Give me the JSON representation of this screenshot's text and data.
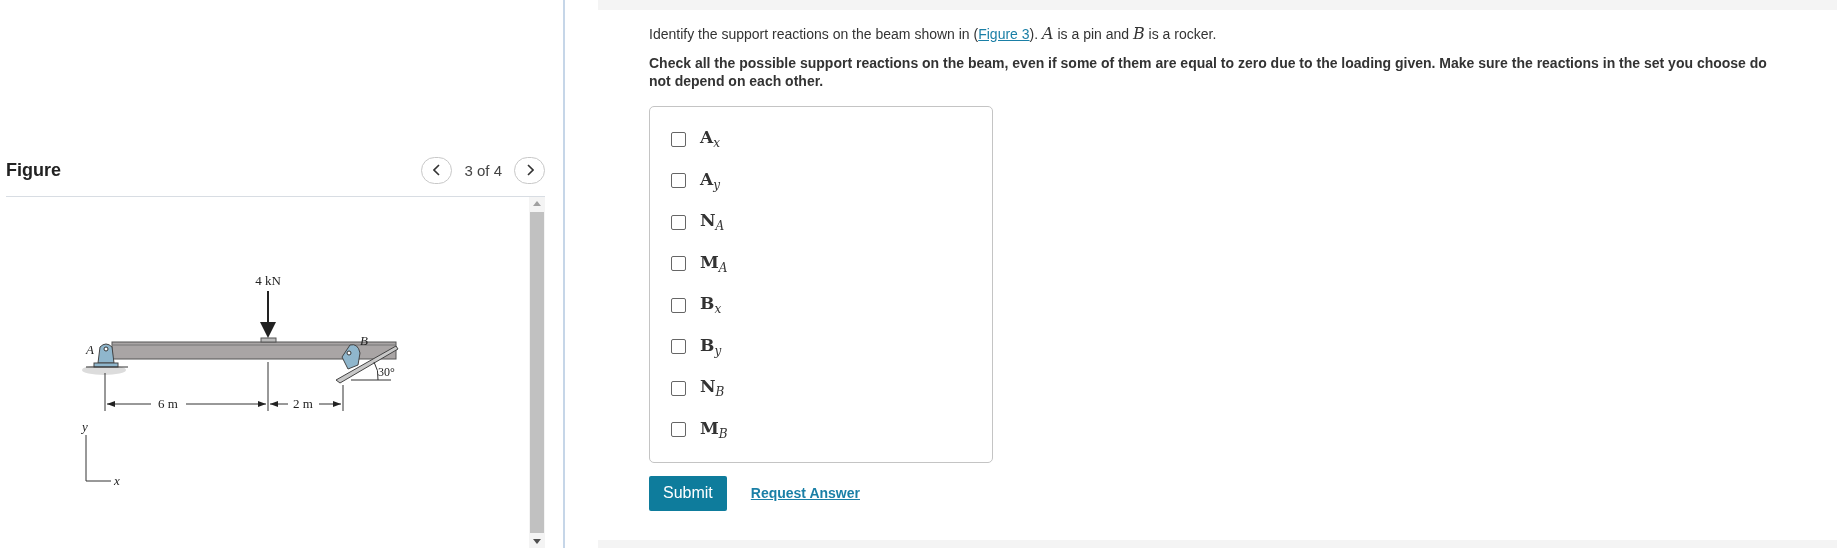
{
  "figure": {
    "title": "Figure",
    "pager": "3 of 4",
    "diagram": {
      "load": "4 kN",
      "point_a": "A",
      "point_b": "B",
      "angle": "30°",
      "span_1": "6 m",
      "span_2": "2 m",
      "axis_y": "y",
      "axis_x": "x"
    }
  },
  "question": {
    "intro_before": "Identify the support reactions on the beam shown in (",
    "link": "Figure 3",
    "intro_after": "). *A* is a pin and *B* is a rocker.",
    "instruction": "Check all the possible support reactions on the beam, even if some of them are equal to zero due to the loading given. Make sure the reactions in the set you choose do not depend on each other.",
    "options": [
      {
        "label": "A$_{x}$",
        "checked": false
      },
      {
        "label": "A$_{y}$",
        "checked": false
      },
      {
        "label": "N$_{A}$",
        "checked": false
      },
      {
        "label": "M$_{A}$",
        "checked": false
      },
      {
        "label": "B$_{x}$",
        "checked": false
      },
      {
        "label": "B$_{y}$",
        "checked": false
      },
      {
        "label": "N$_{B}$",
        "checked": false
      },
      {
        "label": "M$_{B}$",
        "checked": false
      }
    ]
  },
  "actions": {
    "submit": "Submit",
    "request": "Request Answer"
  }
}
